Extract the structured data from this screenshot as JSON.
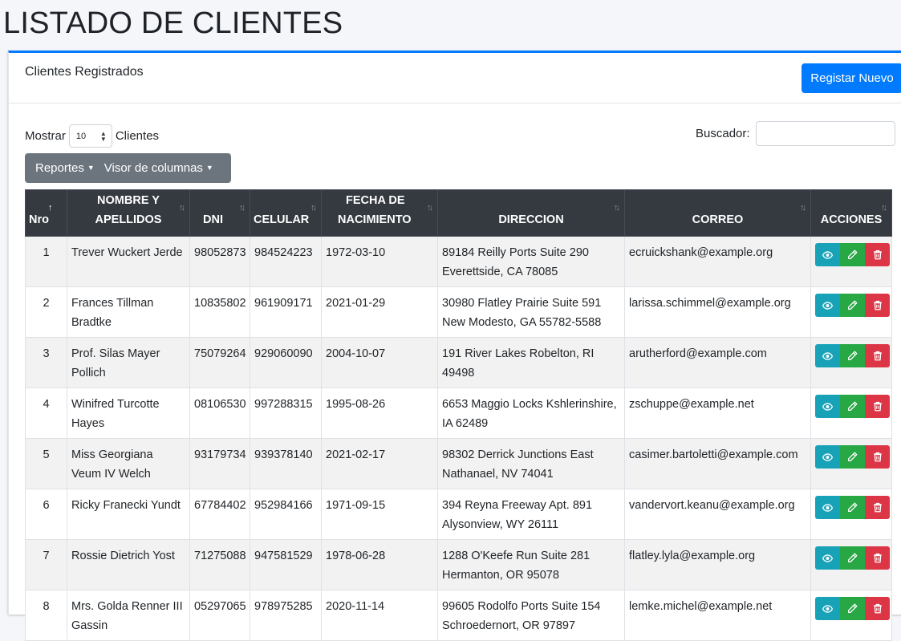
{
  "page": {
    "title": "LISTADO DE CLIENTES"
  },
  "card": {
    "title": "Clientes Registrados",
    "new_button": "Registar Nuevo"
  },
  "controls": {
    "show_label": "Mostrar",
    "page_size": "10",
    "show_suffix": "Clientes",
    "search_label": "Buscador:",
    "search_value": "",
    "reports_label": "Reportes",
    "columns_label": "Visor de columnas"
  },
  "table": {
    "headers": {
      "nro": "Nro",
      "name_1": "NOMBRE Y",
      "name_2": "APELLIDOS",
      "dni": "DNI",
      "celular": "CELULAR",
      "fecha_1": "FECHA DE",
      "fecha_2": "NACIMIENTO",
      "direccion": "DIRECCION",
      "correo": "CORREO",
      "acciones": "ACCIONES"
    },
    "rows": [
      {
        "nro": "1",
        "name": "Trever Wuckert Jerde",
        "dni": "98052873",
        "cel": "984524223",
        "fecha": "1972-03-10",
        "dir": "89184 Reilly Ports Suite 290 Everettside, CA 78085",
        "correo": "ecruickshank@example.org"
      },
      {
        "nro": "2",
        "name": "Frances Tillman Bradtke",
        "dni": "10835802",
        "cel": "961909171",
        "fecha": "2021-01-29",
        "dir": "30980 Flatley Prairie Suite 591 New Modesto, GA 55782-5588",
        "correo": "larissa.schimmel@example.org"
      },
      {
        "nro": "3",
        "name": "Prof. Silas Mayer Pollich",
        "dni": "75079264",
        "cel": "929060090",
        "fecha": "2004-10-07",
        "dir": "191 River Lakes Robelton, RI 49498",
        "correo": "arutherford@example.com"
      },
      {
        "nro": "4",
        "name": "Winifred Turcotte Hayes",
        "dni": "08106530",
        "cel": "997288315",
        "fecha": "1995-08-26",
        "dir": "6653 Maggio Locks Kshlerinshire, IA 62489",
        "correo": "zschuppe@example.net"
      },
      {
        "nro": "5",
        "name": "Miss Georgiana Veum IV Welch",
        "dni": "93179734",
        "cel": "939378140",
        "fecha": "2021-02-17",
        "dir": "98302 Derrick Junctions East Nathanael, NV 74041",
        "correo": "casimer.bartoletti@example.com"
      },
      {
        "nro": "6",
        "name": "Ricky Franecki Yundt",
        "dni": "67784402",
        "cel": "952984166",
        "fecha": "1971-09-15",
        "dir": "394 Reyna Freeway Apt. 891 Alysonview, WY 26111",
        "correo": "vandervort.keanu@example.org"
      },
      {
        "nro": "7",
        "name": "Rossie Dietrich Yost",
        "dni": "71275088",
        "cel": "947581529",
        "fecha": "1978-06-28",
        "dir": "1288 O'Keefe Run Suite 281 Hermanton, OR 95078",
        "correo": "flatley.lyla@example.org"
      },
      {
        "nro": "8",
        "name": "Mrs. Golda Renner III Gassin",
        "dni": "05297065",
        "cel": "978975285",
        "fecha": "2020-11-14",
        "dir": "99605 Rodolfo Ports Suite 154 Schroedernort, OR 97897",
        "correo": "lemke.michel@example.net"
      }
    ]
  },
  "icons": {
    "view": "eye-icon",
    "edit": "pencil-icon",
    "delete": "trash-icon"
  },
  "colors": {
    "primary": "#007bff",
    "info": "#17a2b8",
    "success": "#28a745",
    "danger": "#dc3545",
    "secondary": "#6c757d",
    "header_dark": "#343a40"
  }
}
